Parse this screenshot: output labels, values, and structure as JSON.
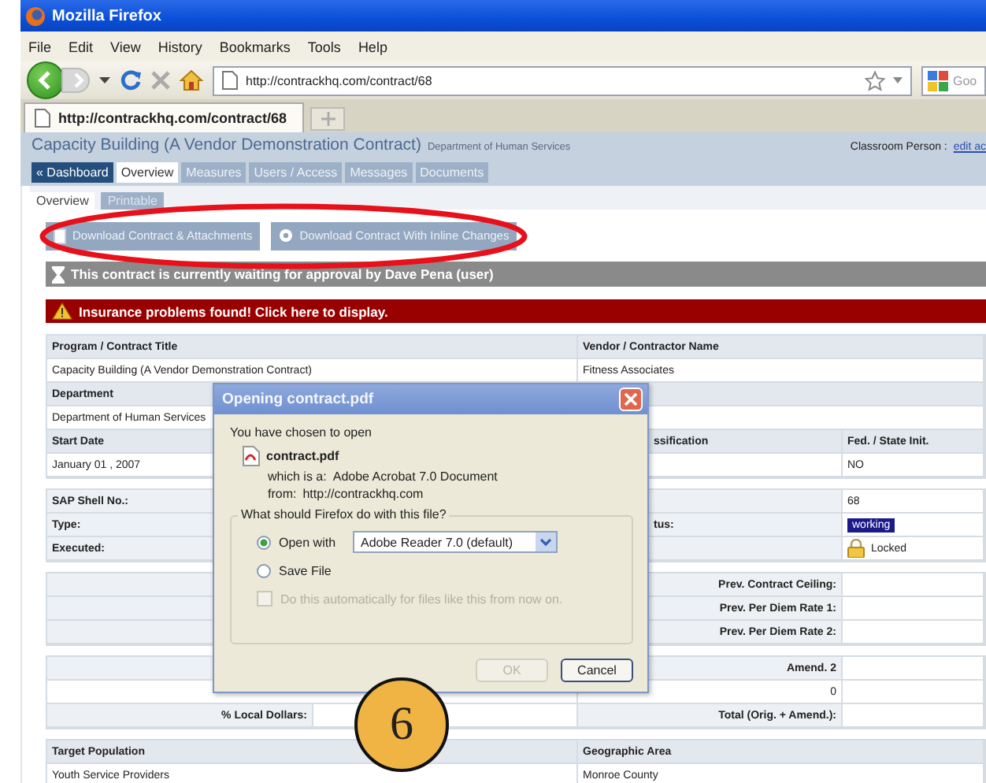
{
  "window": {
    "title": "Mozilla Firefox"
  },
  "menu": [
    "File",
    "Edit",
    "View",
    "History",
    "Bookmarks",
    "Tools",
    "Help"
  ],
  "address_bar": {
    "value": "http://contrackhq.com/contract/68"
  },
  "search_field": {
    "placeholder": "Goo"
  },
  "browser_tabs": [
    {
      "label": "http://contrackhq.com/contract/68",
      "selected": true
    }
  ],
  "page": {
    "title": "Capacity Building (A Vendor Demonstration Contract)",
    "department": "Department of Human Services",
    "user_label": "Classroom Person :",
    "user_link": "edit ac"
  },
  "nav_tabs": [
    {
      "label": "« Dashboard",
      "kind": "back",
      "selected": false
    },
    {
      "label": "Overview",
      "kind": "tab",
      "selected": true
    },
    {
      "label": "Measures",
      "kind": "tab",
      "selected": false
    },
    {
      "label": "Users / Access",
      "kind": "tab",
      "selected": false
    },
    {
      "label": "Messages",
      "kind": "tab",
      "selected": false
    },
    {
      "label": "Documents",
      "kind": "tab",
      "selected": false
    }
  ],
  "sub_tabs": [
    {
      "label": "Overview",
      "selected": true
    },
    {
      "label": "Printable",
      "selected": false
    }
  ],
  "buttons": [
    "Download Contract & Attachments",
    "Download Contract With Inline Changes"
  ],
  "notices": [
    {
      "kind": "pending",
      "text": "This contract is currently waiting for approval by Dave Pena (user)"
    },
    {
      "kind": "alert",
      "text": "Insurance problems found! Click here to display."
    }
  ],
  "sections": [
    {
      "kind": "fields",
      "rows": [
        [
          {
            "kind": "head",
            "text": "Program / Contract Title"
          },
          {
            "kind": "head",
            "text": "Vendor / Contractor Name"
          }
        ],
        [
          {
            "kind": "value",
            "text": "Capacity Building (A Vendor Demonstration Contract)"
          },
          {
            "kind": "value",
            "text": "Fitness Associates"
          }
        ],
        [
          {
            "kind": "head",
            "text": "Department"
          },
          {
            "kind": "head"
          }
        ],
        [
          {
            "kind": "value",
            "text": "Department of Human Services"
          },
          {
            "kind": "value"
          }
        ],
        [
          {
            "kind": "head",
            "text": "Start Date"
          },
          {
            "kind": "head",
            "text": "ssification"
          },
          {
            "kind": "head",
            "text": "Fed. / State Init."
          }
        ],
        [
          {
            "kind": "value",
            "text": "January 01 , 2007"
          },
          {
            "kind": "value"
          },
          {
            "kind": "value",
            "text": "NO"
          }
        ]
      ]
    },
    {
      "kind": "fields",
      "rows": [
        [
          {
            "kind": "label",
            "text": "SAP Shell No.:"
          },
          {
            "kind": "label"
          },
          {
            "kind": "value",
            "text": "68"
          }
        ],
        [
          {
            "kind": "label",
            "text": "Type:"
          },
          {
            "kind": "label",
            "text": "tus:"
          },
          {
            "kind": "badge",
            "text": "working"
          }
        ],
        [
          {
            "kind": "label",
            "text": "Executed:"
          },
          {
            "kind": "label"
          },
          {
            "kind": "lock",
            "text": "Locked"
          }
        ]
      ]
    },
    {
      "kind": "amounts",
      "rows": [
        [
          {
            "kind": "label"
          },
          {
            "kind": "label",
            "text": "Prev. Contract Ceiling:"
          },
          {
            "kind": "value"
          }
        ],
        [
          {
            "kind": "label"
          },
          {
            "kind": "label",
            "text": "Prev. Per Diem Rate 1:"
          },
          {
            "kind": "value"
          }
        ],
        [
          {
            "kind": "label"
          },
          {
            "kind": "label",
            "text": "Prev. Per Diem Rate 2:"
          },
          {
            "kind": "value"
          }
        ]
      ]
    },
    {
      "kind": "amounts",
      "rows": [
        [
          {
            "kind": "label"
          },
          {
            "kind": "label",
            "text": "Amend. 2"
          },
          {
            "kind": "value"
          }
        ],
        [
          {
            "kind": "value"
          },
          {
            "kind": "value",
            "text": "0"
          },
          {
            "kind": "value"
          }
        ],
        [
          {
            "kind": "label",
            "text": "% Local Dollars:"
          },
          {
            "kind": "value"
          },
          {
            "kind": "label",
            "text": "Total (Orig. + Amend.):"
          },
          {
            "kind": "value"
          }
        ]
      ]
    },
    {
      "kind": "fields",
      "rows": [
        [
          {
            "kind": "head",
            "text": "Target Population"
          },
          {
            "kind": "head",
            "text": "Geographic Area"
          }
        ],
        [
          {
            "kind": "value",
            "text": "Youth Service Providers"
          },
          {
            "kind": "value",
            "text": "Monroe County"
          }
        ]
      ]
    }
  ],
  "dialog": {
    "title": "Opening contract.pdf",
    "intro": "You have chosen to open",
    "file_name": "contract.pdf",
    "type_label": "which is a:",
    "type_value": "Adobe Acrobat 7.0 Document",
    "from_label": "from:",
    "from_value": "http://contrackhq.com",
    "question": "What should Firefox do with this file?",
    "options": [
      {
        "label": "Open with",
        "selected": true
      },
      {
        "label": "Save File",
        "selected": false
      }
    ],
    "app_select": {
      "value": "Adobe Reader 7.0 (default)"
    },
    "remember": {
      "label": "Do this automatically for files like this from now on.",
      "checked": false,
      "disabled": true
    },
    "buttons": [
      {
        "label": "OK",
        "disabled": true
      },
      {
        "label": "Cancel",
        "disabled": false
      }
    ]
  },
  "annotations": {
    "ellipse": true,
    "step_badge": "6"
  }
}
